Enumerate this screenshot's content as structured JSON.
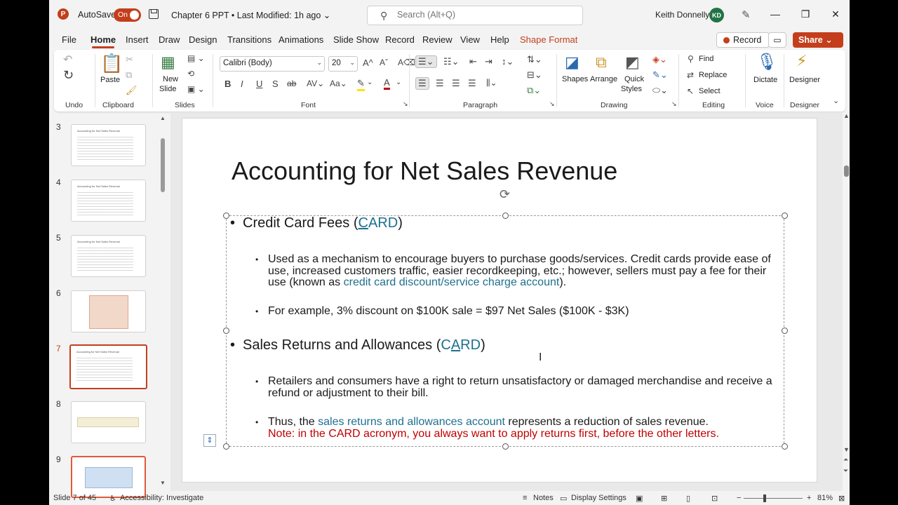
{
  "titlebar": {
    "app_logo": "P",
    "autosave_label": "AutoSave",
    "autosave_state": "On",
    "doc_title": "Chapter 6 PPT • Last Modified: 1h ago ⌄",
    "search_placeholder": "Search (Alt+Q)",
    "user_name": "Keith Donnelly",
    "user_initials": "KD"
  },
  "tabs": [
    "File",
    "Home",
    "Insert",
    "Draw",
    "Design",
    "Transitions",
    "Animations",
    "Slide Show",
    "Record",
    "Review",
    "View",
    "Help",
    "Shape Format"
  ],
  "active_tab": "Home",
  "record_label": "Record",
  "share_label": "Share",
  "ribbon": {
    "groups": {
      "undo": "Undo",
      "clipboard": "Clipboard",
      "slides": "Slides",
      "font": "Font",
      "paragraph": "Paragraph",
      "drawing": "Drawing",
      "editing": "Editing",
      "voice": "Voice",
      "designer": "Designer"
    },
    "paste": "Paste",
    "new_slide_line1": "New",
    "new_slide_line2": "Slide",
    "font_name": "Calibri (Body)",
    "font_size": "20",
    "shapes": "Shapes",
    "arrange": "Arrange",
    "quick_styles_line1": "Quick",
    "quick_styles_line2": "Styles",
    "find": "Find",
    "replace": "Replace",
    "select": "Select",
    "dictate": "Dictate",
    "designer": "Designer"
  },
  "thumbnails": [
    {
      "num": "3",
      "title": "Accounting for Net Sales Revenue"
    },
    {
      "num": "4",
      "title": "Accounting for Net Sales Revenue"
    },
    {
      "num": "5",
      "title": "Accounting for Net Sales Revenue"
    },
    {
      "num": "6",
      "title": ""
    },
    {
      "num": "7",
      "title": "Accounting for Net Sales Revenue"
    },
    {
      "num": "8",
      "title": ""
    },
    {
      "num": "9",
      "title": ""
    }
  ],
  "slide": {
    "title": "Accounting for Net Sales Revenue",
    "bullet1_prefix": "Credit Card Fees (",
    "bullet1_c": "C",
    "bullet1_rest": "ARD",
    "bullet1_suffix": ")",
    "sub1_a": "Used as a mechanism to encourage buyers to purchase goods/services. Credit cards provide ease of use, increased customers traffic, easier recordkeeping, etc.; however, sellers must pay a fee for their use (known as ",
    "sub1_link": "credit card discount/service charge account",
    "sub1_end": ").",
    "sub2": "For example, 3% discount on $100K sale = $97 Net Sales ($100K - $3K)",
    "bullet2_prefix": "Sales Returns and Allowances (",
    "bullet2_c": "C",
    "bullet2_a": "A",
    "bullet2_rest": "RD",
    "bullet2_suffix": ")",
    "sub3": "Retailers and consumers have a right to return unsatisfactory or damaged merchandise and receive a refund or adjustment to their bill.",
    "sub4_a": "Thus, the ",
    "sub4_link": "sales returns and allowances account",
    "sub4_b": " represents a reduction of sales revenue.",
    "sub4_note": "Note: in the CARD acronym, you always want to apply returns first, before the other letters."
  },
  "status": {
    "slide_count": "Slide 7 of 45",
    "accessibility": "Accessibility: Investigate",
    "notes": "Notes",
    "display_settings": "Display Settings",
    "zoom": "81%"
  },
  "colors": {
    "accent": "#c43e1c",
    "teal": "#1f6f8f",
    "red": "#c00000"
  }
}
